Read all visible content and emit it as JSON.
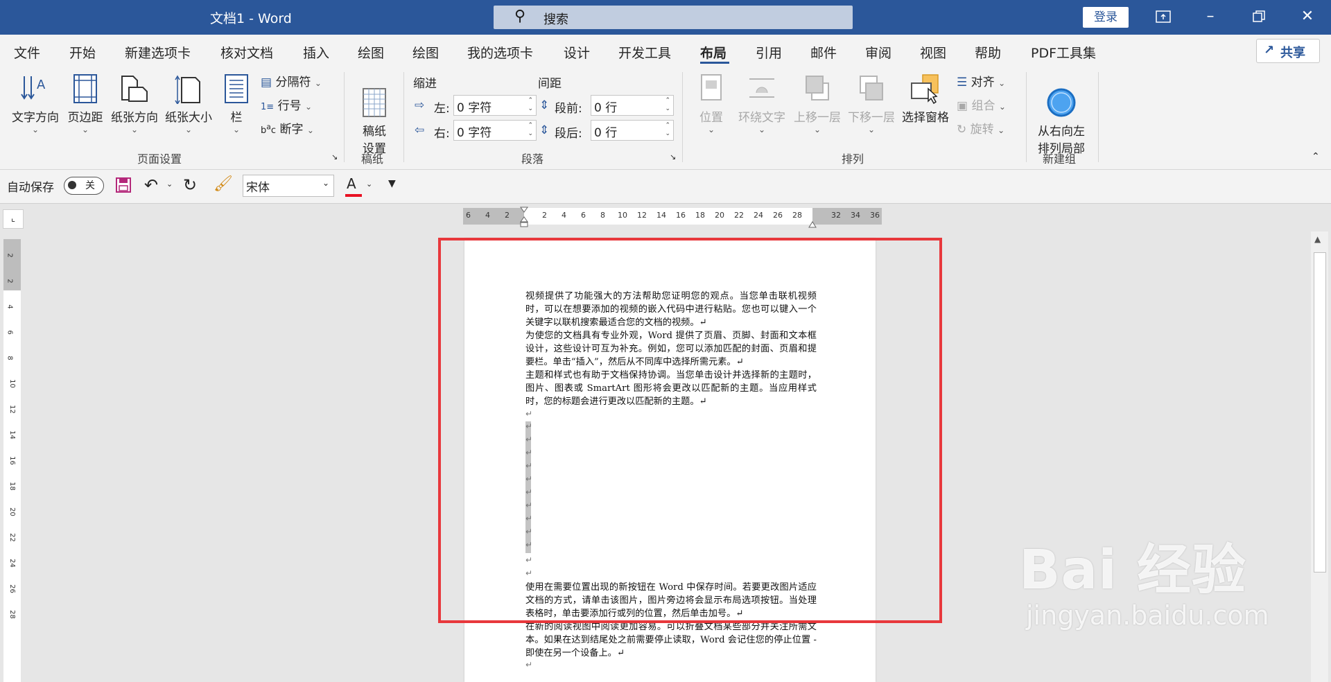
{
  "titlebar": {
    "title": "文档1  -  Word",
    "search_placeholder": "搜索",
    "login_label": "登录"
  },
  "menu": {
    "tabs": [
      "文件",
      "开始",
      "新建选项卡",
      "核对文档",
      "插入",
      "绘图",
      "绘图",
      "我的选项卡",
      "设计",
      "开发工具",
      "布局",
      "引用",
      "邮件",
      "审阅",
      "视图",
      "帮助",
      "PDF工具集"
    ],
    "active_tab": "布局",
    "share_label": "共享"
  },
  "ribbon": {
    "page_setup": {
      "text_direction": "文字方向",
      "margins": "页边距",
      "orientation": "纸张方向",
      "size": "纸张大小",
      "columns": "栏",
      "breaks": "分隔符",
      "line_numbers": "行号",
      "hyphenation": "断字",
      "group_label": "页面设置"
    },
    "manuscript": {
      "settings": "稿纸\n设置",
      "group_label": "稿纸"
    },
    "paragraph": {
      "indent_title": "缩进",
      "spacing_title": "间距",
      "left_label": "左:",
      "left_value": "0 字符",
      "right_label": "右:",
      "right_value": "0 字符",
      "before_label": "段前:",
      "before_value": "0 行",
      "after_label": "段后:",
      "after_value": "0 行",
      "group_label": "段落"
    },
    "arrange": {
      "position": "位置",
      "wrap_text": "环绕文字",
      "bring_forward": "上移一层",
      "send_backward": "下移一层",
      "selection_pane": "选择窗格",
      "align": "对齐",
      "group": "组合",
      "rotate": "旋转",
      "group_label": "排列"
    },
    "new_group": {
      "rtl_layout": "从右向左\n排列局部",
      "group_label": "新建组"
    }
  },
  "qat": {
    "autosave_label": "自动保存",
    "toggle_state": "关",
    "font_name": "宋体",
    "font_color": "#e81123"
  },
  "ruler": {
    "h_left_numbers": [
      "6",
      "4",
      "2"
    ],
    "h_numbers": [
      "2",
      "4",
      "6",
      "8",
      "10",
      "12",
      "14",
      "16",
      "18",
      "20",
      "22",
      "24",
      "26",
      "28"
    ],
    "h_right_numbers": [
      "32",
      "34",
      "36"
    ],
    "v_numbers": [
      "2",
      "2",
      "4",
      "6",
      "8",
      "10",
      "12",
      "14",
      "16",
      "18",
      "20",
      "22",
      "24",
      "26",
      "28"
    ]
  },
  "document": {
    "p1": "视频提供了功能强大的方法帮助您证明您的观点。当您单击联机视频时，可以在想要添加的视频的嵌入代码中进行粘贴。您也可以键入一个关键字以联机搜索最适合您的文档的视频。↵",
    "p2": "为使您的文档具有专业外观，Word 提供了页眉、页脚、封面和文本框设计，这些设计可互为补充。例如，您可以添加匹配的封面、页眉和提要栏。单击“插入”，然后从不同库中选择所需元素。↵",
    "p3": "主题和样式也有助于文档保持协调。当您单击设计并选择新的主题时，图片、图表或 SmartArt 图形将会更改以匹配新的主题。当应用样式时，您的标题会进行更改以匹配新的主题。↵",
    "p4": "使用在需要位置出现的新按钮在 Word 中保存时间。若要更改图片适应文档的方式，请单击该图片，图片旁边将会显示布局选项按钮。当处理表格时，单击要添加行或列的位置，然后单击加号。↵",
    "p5": "在新的阅读视图中阅读更加容易。可以折叠文档某些部分并关注所需文本。如果在达到结尾处之前需要停止读取，Word 会记住您的停止位置 - 即使在另一个设备上。↵",
    "para_mark": "↵"
  },
  "watermark": {
    "brand": "Bai 经验",
    "url": "jingyan.baidu.com"
  }
}
